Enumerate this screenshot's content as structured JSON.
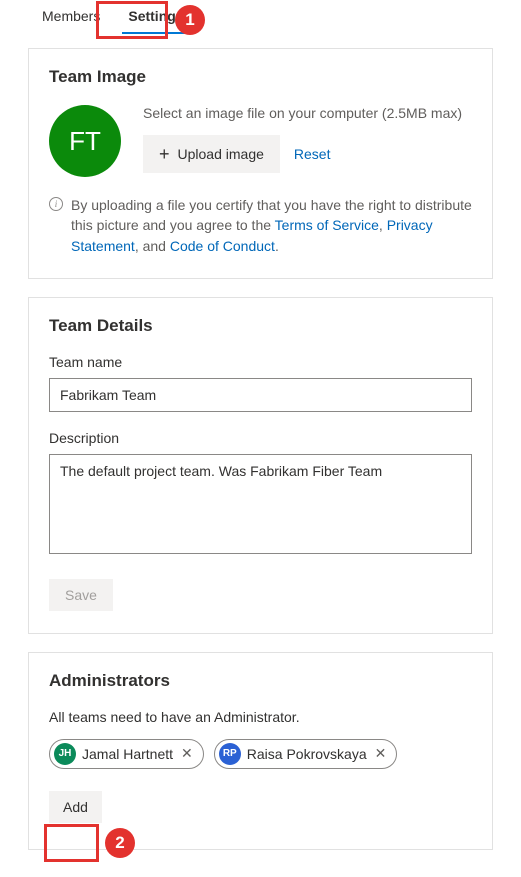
{
  "tabs": {
    "members": "Members",
    "settings": "Settings"
  },
  "callouts": {
    "n1": "1",
    "n2": "2"
  },
  "teamImage": {
    "heading": "Team Image",
    "avatarInitials": "FT",
    "hint": "Select an image file on your computer (2.5MB max)",
    "uploadLabel": "Upload image",
    "resetLabel": "Reset",
    "disclaimerPrefix": "By uploading a file you certify that you have the right to distribute this picture and you agree to the ",
    "tos": "Terms of Service",
    "sep1": ", ",
    "privacy": "Privacy Statement",
    "sep2": ", and ",
    "coc": "Code of Conduct",
    "period": "."
  },
  "teamDetails": {
    "heading": "Team Details",
    "nameLabel": "Team name",
    "nameValue": "Fabrikam Team",
    "descLabel": "Description",
    "descValue": "The default project team. Was Fabrikam Fiber Team",
    "saveLabel": "Save"
  },
  "admins": {
    "heading": "Administrators",
    "note": "All teams need to have an Administrator.",
    "people": [
      {
        "initials": "JH",
        "name": "Jamal Hartnett",
        "color": "#0b8a5a"
      },
      {
        "initials": "RP",
        "name": "Raisa Pokrovskaya",
        "color": "#2b61d4"
      }
    ],
    "addLabel": "Add"
  }
}
